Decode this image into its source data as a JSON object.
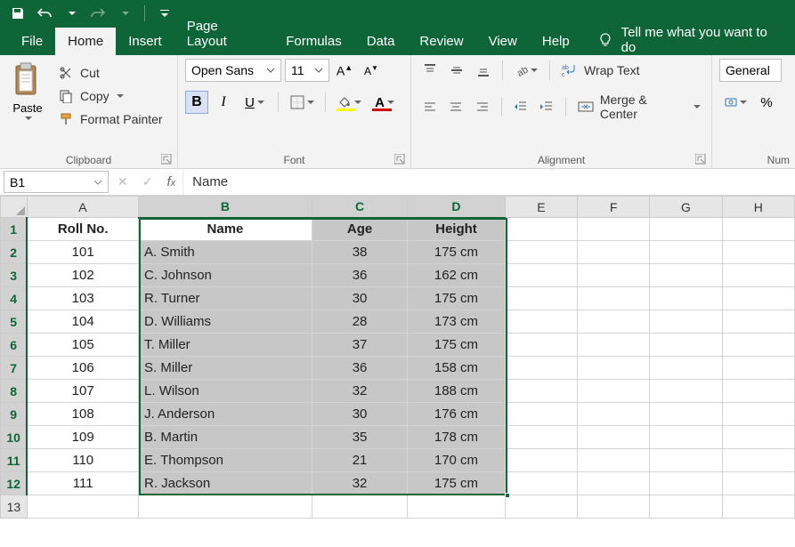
{
  "qat": {
    "save": "save-icon",
    "undo": "undo-icon",
    "redo": "redo-icon"
  },
  "tabs": [
    "File",
    "Home",
    "Insert",
    "Page Layout",
    "Formulas",
    "Data",
    "Review",
    "View",
    "Help"
  ],
  "active_tab": "Home",
  "tell_me": "Tell me what you want to do",
  "ribbon": {
    "clipboard": {
      "label": "Clipboard",
      "paste": "Paste",
      "cut": "Cut",
      "copy": "Copy",
      "format_painter": "Format Painter"
    },
    "font": {
      "label": "Font",
      "name": "Open Sans",
      "size": "11"
    },
    "alignment": {
      "label": "Alignment",
      "wrap": "Wrap Text",
      "merge": "Merge & Center"
    },
    "number": {
      "label": "Num",
      "format": "General"
    }
  },
  "namebox": "B1",
  "formula": "Name",
  "columns": [
    "A",
    "B",
    "C",
    "D",
    "E",
    "F",
    "G",
    "H"
  ],
  "sel_cols": [
    "B",
    "C",
    "D"
  ],
  "sel_rows": [
    1,
    2,
    3,
    4,
    5,
    6,
    7,
    8,
    9,
    10,
    11,
    12
  ],
  "headers": {
    "A": "Roll No.",
    "B": "Name",
    "C": "Age",
    "D": "Height"
  },
  "data_rows": [
    {
      "A": "101",
      "B": "A. Smith",
      "C": "38",
      "D": "175 cm"
    },
    {
      "A": "102",
      "B": "C. Johnson",
      "C": "36",
      "D": "162 cm"
    },
    {
      "A": "103",
      "B": "R. Turner",
      "C": "30",
      "D": "175 cm"
    },
    {
      "A": "104",
      "B": "D. Williams",
      "C": "28",
      "D": "173 cm"
    },
    {
      "A": "105",
      "B": "T. Miller",
      "C": "37",
      "D": "175 cm"
    },
    {
      "A": "106",
      "B": "S. Miller",
      "C": "36",
      "D": "158 cm"
    },
    {
      "A": "107",
      "B": "L. Wilson",
      "C": "32",
      "D": "188 cm"
    },
    {
      "A": "108",
      "B": "J. Anderson",
      "C": "30",
      "D": "176 cm"
    },
    {
      "A": "109",
      "B": "B. Martin",
      "C": "35",
      "D": "178 cm"
    },
    {
      "A": "110",
      "B": "E. Thompson",
      "C": "21",
      "D": "170 cm"
    },
    {
      "A": "111",
      "B": "R. Jackson",
      "C": "32",
      "D": "175 cm"
    }
  ],
  "chart_data": {
    "type": "table",
    "columns": [
      "Roll No.",
      "Name",
      "Age",
      "Height"
    ],
    "rows": [
      [
        101,
        "A. Smith",
        38,
        "175 cm"
      ],
      [
        102,
        "C. Johnson",
        36,
        "162 cm"
      ],
      [
        103,
        "R. Turner",
        30,
        "175 cm"
      ],
      [
        104,
        "D. Williams",
        28,
        "173 cm"
      ],
      [
        105,
        "T. Miller",
        37,
        "175 cm"
      ],
      [
        106,
        "S. Miller",
        36,
        "158 cm"
      ],
      [
        107,
        "L. Wilson",
        32,
        "188 cm"
      ],
      [
        108,
        "J. Anderson",
        30,
        "176 cm"
      ],
      [
        109,
        "B. Martin",
        35,
        "178 cm"
      ],
      [
        110,
        "E. Thompson",
        21,
        "170 cm"
      ],
      [
        111,
        "R. Jackson",
        32,
        "175 cm"
      ]
    ]
  }
}
